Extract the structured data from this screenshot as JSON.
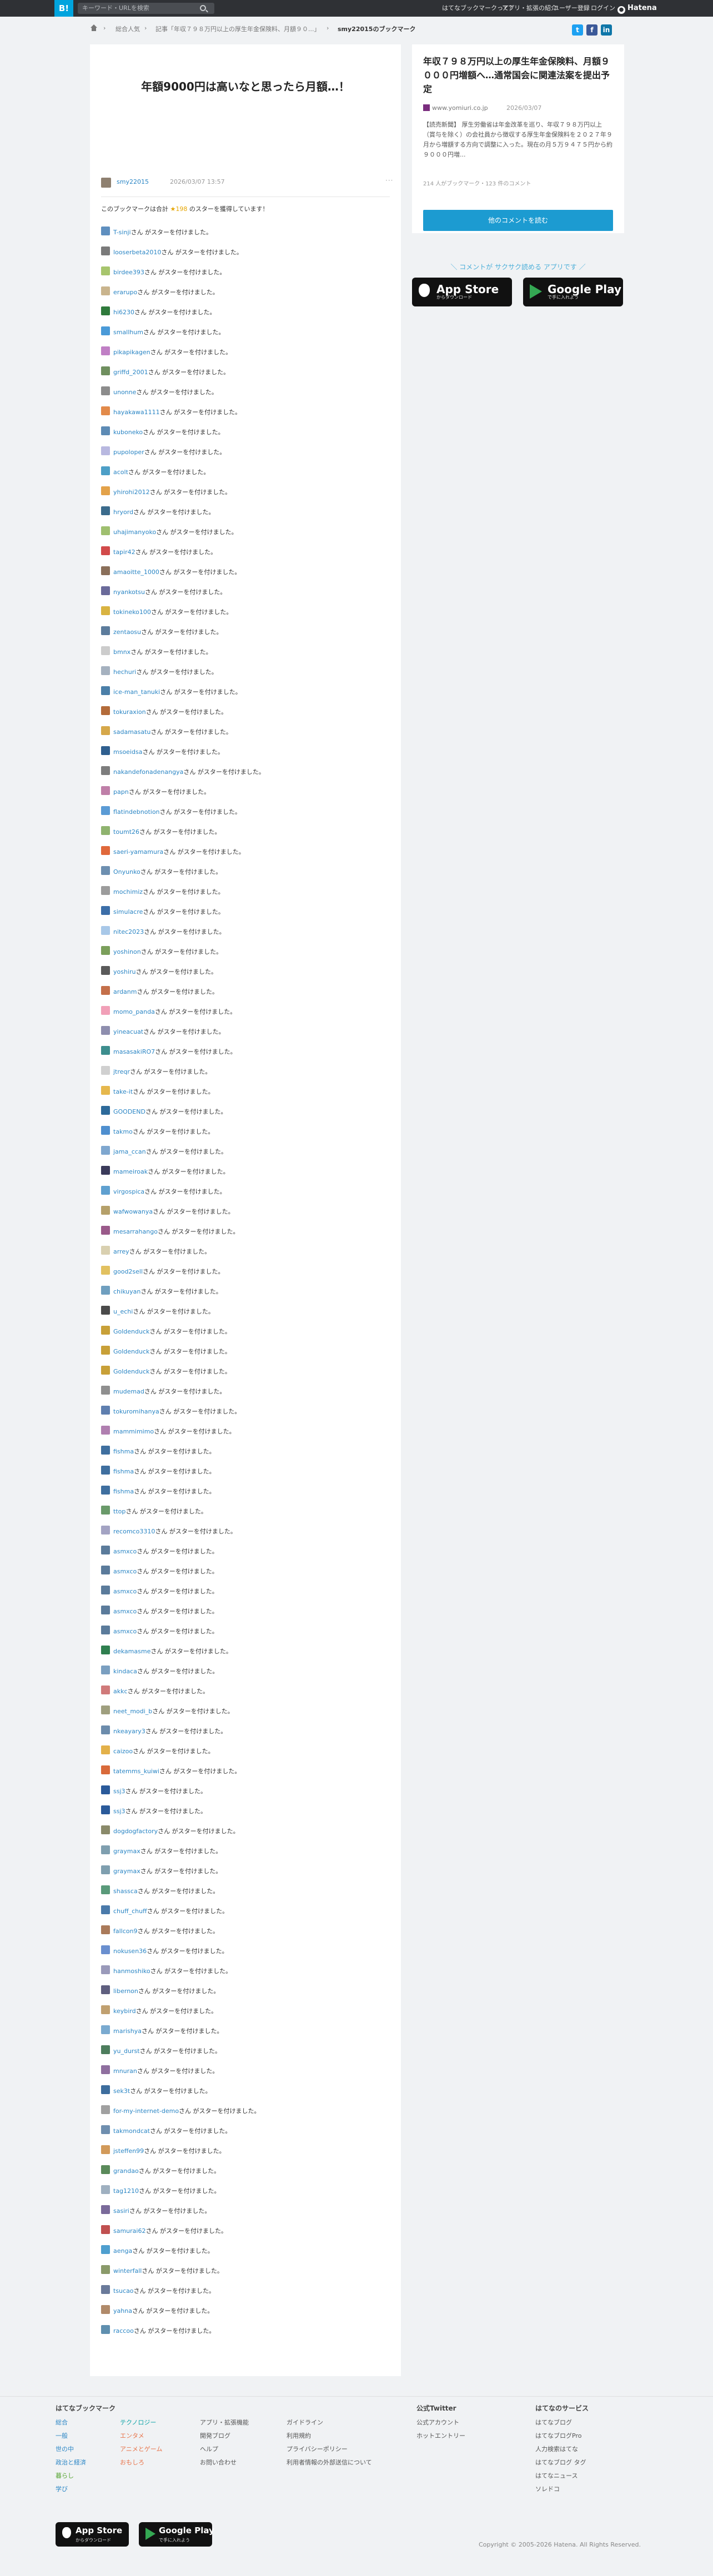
{
  "header": {
    "logo": "B!",
    "search_placeholder": "キーワード・URLを検索",
    "nav": [
      "はてなブックマークって？",
      "アプリ・拡張の紹介",
      "ユーザー登録",
      "ログイン"
    ],
    "brand": "Hatena"
  },
  "breadcrumb": [
    "総合人気",
    "記事「年収７９８万円以上の厚生年金保険料、月額９０...」",
    "smy22015のブックマーク"
  ],
  "social": [
    "t",
    "f",
    "in"
  ],
  "bookmark": {
    "comment": "年額9000円は高いなと思ったら月額…！",
    "author": "smy22015",
    "date": "2026/03/07 13:57",
    "more": "···"
  },
  "summary": {
    "prefix": "このブックマークは合計",
    "count": "★198",
    "suffix": "のスターを獲得しています！"
  },
  "star_suffix": "さん がスターを付けました。",
  "stars": [
    {
      "n": "T-sinji",
      "c": "#5f8fbf"
    },
    {
      "n": "looserbeta2010",
      "c": "#7a7a7a"
    },
    {
      "n": "birdee393",
      "c": "#a7c56d"
    },
    {
      "n": "erarupo",
      "c": "#c9b48d"
    },
    {
      "n": "hi6230",
      "c": "#2f7a3c"
    },
    {
      "n": "smallhum",
      "c": "#4a9ad8"
    },
    {
      "n": "pikapikagen",
      "c": "#c07fc5"
    },
    {
      "n": "griffd_2001",
      "c": "#6f8f5f"
    },
    {
      "n": "unonne",
      "c": "#8c8c8c"
    },
    {
      "n": "hayakawa1111",
      "c": "#e28a4a"
    },
    {
      "n": "kuboneko",
      "c": "#5d8bb5"
    },
    {
      "n": "pupoloper",
      "c": "#b8b8e0"
    },
    {
      "n": "acolt",
      "c": "#4d9fc7"
    },
    {
      "n": "yhirohi2012",
      "c": "#e3a24a"
    },
    {
      "n": "hryord",
      "c": "#3b6b8c"
    },
    {
      "n": "uhajimanyoko",
      "c": "#9fbf6f"
    },
    {
      "n": "tapir42",
      "c": "#d24a4a"
    },
    {
      "n": "amaoitte_1000",
      "c": "#8a6f5a"
    },
    {
      "n": "nyankotsu",
      "c": "#6a6a9a"
    },
    {
      "n": "tokineko100",
      "c": "#d9b341"
    },
    {
      "n": "zentaosu",
      "c": "#5c7c9c"
    },
    {
      "n": "bmnx",
      "c": "#cccccc"
    },
    {
      "n": "hechuri",
      "c": "#a5b1bf"
    },
    {
      "n": "ice-man_tanuki",
      "c": "#4b7fa8"
    },
    {
      "n": "tokuraxion",
      "c": "#b36b3a"
    },
    {
      "n": "sadamasatu",
      "c": "#d6a84a"
    },
    {
      "n": "msoeidsa",
      "c": "#2f5f8f"
    },
    {
      "n": "nakandefonadenangya",
      "c": "#7d7d7d"
    },
    {
      "n": "papn",
      "c": "#bf7fa8"
    },
    {
      "n": "flatindebnotion",
      "c": "#5b9bd5"
    },
    {
      "n": "toumt26",
      "c": "#8fb36f"
    },
    {
      "n": "saeri-yamamura",
      "c": "#e0683b"
    },
    {
      "n": "Onyunko",
      "c": "#6d8fb0"
    },
    {
      "n": "mochimiz",
      "c": "#9c9c9c"
    },
    {
      "n": "simulacre",
      "c": "#3c6ea8"
    },
    {
      "n": "nitec2023",
      "c": "#a8c8e8"
    },
    {
      "n": "yoshinon",
      "c": "#7b9f5b"
    },
    {
      "n": "yoshiru",
      "c": "#5a5a5a"
    },
    {
      "n": "ardanm",
      "c": "#c46f4a"
    },
    {
      "n": "momo_panda",
      "c": "#f1a0b8"
    },
    {
      "n": "yineacuat",
      "c": "#8e8eae"
    },
    {
      "n": "masasakiRO7",
      "c": "#3d8e8e"
    },
    {
      "n": "jtreqr",
      "c": "#d0d0d0"
    },
    {
      "n": "take-it",
      "c": "#e6b84d"
    },
    {
      "n": "GOODEND",
      "c": "#2d6a9a"
    },
    {
      "n": "takmo",
      "c": "#4f8fcf"
    },
    {
      "n": "jama_ccan",
      "c": "#7fa7cf"
    },
    {
      "n": "mameiroak",
      "c": "#3a3a5a"
    },
    {
      "n": "virgospica",
      "c": "#5fa0d0"
    },
    {
      "n": "wafwowanya",
      "c": "#b5a06a"
    },
    {
      "n": "mesarrahango",
      "c": "#9a5a8a"
    },
    {
      "n": "arrey",
      "c": "#d9d0b0"
    },
    {
      "n": "good2sell",
      "c": "#e2c160"
    },
    {
      "n": "chikuyan",
      "c": "#6f9fbf"
    },
    {
      "n": "u_echi",
      "c": "#4a4a4a"
    },
    {
      "n": "Goldenduck",
      "c": "#c8a038"
    },
    {
      "n": "Goldenduck",
      "c": "#c8a038"
    },
    {
      "n": "Goldenduck",
      "c": "#c8a038"
    },
    {
      "n": "mudemad",
      "c": "#8f8f8f"
    },
    {
      "n": "tokuromihanya",
      "c": "#5f7faf"
    },
    {
      "n": "mammimimo",
      "c": "#b07fb0"
    },
    {
      "n": "fishma",
      "c": "#3f6f9f"
    },
    {
      "n": "fishma",
      "c": "#3f6f9f"
    },
    {
      "n": "fishma",
      "c": "#3f6f9f"
    },
    {
      "n": "ttop",
      "c": "#6a9a6a"
    },
    {
      "n": "recomco3310",
      "c": "#a3a3c3"
    },
    {
      "n": "asmxco",
      "c": "#5b7b9b"
    },
    {
      "n": "asmxco",
      "c": "#5b7b9b"
    },
    {
      "n": "asmxco",
      "c": "#5b7b9b"
    },
    {
      "n": "asmxco",
      "c": "#5b7b9b"
    },
    {
      "n": "asmxco",
      "c": "#5b7b9b"
    },
    {
      "n": "dekamasme",
      "c": "#2f7f4f"
    },
    {
      "n": "kindaca",
      "c": "#7a9fc0"
    },
    {
      "n": "akkc",
      "c": "#d07a7a"
    },
    {
      "n": "neet_modi_b",
      "c": "#9f9f7f"
    },
    {
      "n": "nkeayary3",
      "c": "#6c8cac"
    },
    {
      "n": "caizoo",
      "c": "#e3b14a"
    },
    {
      "n": "tatemms_kuiwi",
      "c": "#d96a3a"
    },
    {
      "n": "ssj3",
      "c": "#2a5a9a"
    },
    {
      "n": "ssj3",
      "c": "#2a5a9a"
    },
    {
      "n": "dogdogfactory",
      "c": "#8a8a6a"
    },
    {
      "n": "graymax",
      "c": "#7f9faf"
    },
    {
      "n": "graymax",
      "c": "#7f9faf"
    },
    {
      "n": "shassca",
      "c": "#5a9a7a"
    },
    {
      "n": "chuff_chuff",
      "c": "#4a7aaa"
    },
    {
      "n": "fallcon9",
      "c": "#aa7a5a"
    },
    {
      "n": "nokusen36",
      "c": "#6a8fcf"
    },
    {
      "n": "hanmoshiko",
      "c": "#9a9aba"
    },
    {
      "n": "libernon",
      "c": "#5f5f7f"
    },
    {
      "n": "keybird",
      "c": "#c0a070"
    },
    {
      "n": "marishya",
      "c": "#7aaad0"
    },
    {
      "n": "yu_durst",
      "c": "#4d7d5d"
    },
    {
      "n": "mnuran",
      "c": "#8f6f9f"
    },
    {
      "n": "sek3t",
      "c": "#3d6d9d"
    },
    {
      "n": "for-my-internet-demo",
      "c": "#a0a0a0"
    },
    {
      "n": "takmondcat",
      "c": "#6f8faf"
    },
    {
      "n": "jsteffen99",
      "c": "#d29a5a"
    },
    {
      "n": "grandao",
      "c": "#5a8a5a"
    },
    {
      "n": "tag1210",
      "c": "#9fb0c0"
    },
    {
      "n": "sasiri",
      "c": "#7a6a9a"
    },
    {
      "n": "samurai62",
      "c": "#c05050"
    },
    {
      "n": "aenga",
      "c": "#4f9fcf"
    },
    {
      "n": "winterfall",
      "c": "#8a9a6a"
    },
    {
      "n": "tsucao",
      "c": "#6a7a9a"
    },
    {
      "n": "yahna",
      "c": "#b08a6a"
    },
    {
      "n": "raccoo",
      "c": "#5f8faf"
    }
  ],
  "sidebar": {
    "title": "年収７９８万円以上の厚生年金保険料、月額９０００円増額へ…通常国会に関連法案を提出予定",
    "site": "www.yomiuri.co.jp",
    "date": "2026/03/07",
    "desc": "【読売新聞】 厚生労働省は年金改革を巡り、年収７９８万円以上（賞与を除く）の会社員から徴収する厚生年金保険料を２０２７年９月から増額する方向で調整に入った。現在の月５万９４７５円から約９０００円増...",
    "meta": "214 人がブックマーク・123 件のコメント",
    "button": "他のコメントを読む"
  },
  "promo": "＼ コメントが サクサク読める アプリです ／",
  "stores": {
    "apple_small": "からダウンロード",
    "apple_big": "App Store",
    "google_small": "で手に入れよう",
    "google_big": "Google Play"
  },
  "footer": {
    "col1_head": "はてなブックマーク",
    "cats1": [
      "総合",
      "一般",
      "世の中",
      "政治と経済",
      "暮らし",
      "学び"
    ],
    "cats2": [
      "テクノロジー",
      "エンタメ",
      "アニメとゲーム",
      "おもしろ"
    ],
    "col3": [
      "アプリ・拡張機能",
      "開発ブログ",
      "ヘルプ",
      "お問い合わせ"
    ],
    "col4": [
      "ガイドライン",
      "利用規約",
      "プライバシーポリシー",
      "利用者情報の外部送信について"
    ],
    "twitter_head": "公式Twitter",
    "twitter": [
      "公式アカウント",
      "ホットエントリー"
    ],
    "services_head": "はてなのサービス",
    "services": [
      "はてなブログ",
      "はてなブログPro",
      "人力検索はてな",
      "はてなブログ タグ",
      "はてなニュース",
      "ソレドコ"
    ],
    "copyright": "Copyright © 2005-2026 Hatena. All Rights Reserved."
  }
}
